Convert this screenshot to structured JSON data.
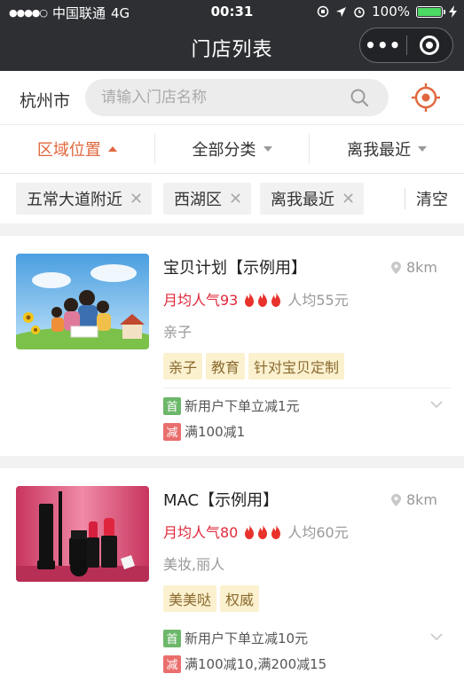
{
  "status_bar": {
    "carrier": "中国联通",
    "network": "4G",
    "time": "00:31",
    "battery": "100%"
  },
  "nav": {
    "title": "门店列表"
  },
  "search": {
    "city": "杭州市",
    "placeholder": "请输入门店名称"
  },
  "filters": [
    {
      "label": "区域位置",
      "active": true
    },
    {
      "label": "全部分类",
      "active": false
    },
    {
      "label": "离我最近",
      "active": false
    }
  ],
  "selected_filters": {
    "chips": [
      "五常大道附近",
      "西湖区",
      "离我最近"
    ],
    "clear_label": "清空"
  },
  "stores": [
    {
      "name": "宝贝计划【示例用】",
      "distance": "8km",
      "popularity": "月均人气93",
      "avg_price": "人均55元",
      "category": "亲子",
      "tags": [
        "亲子",
        "教育",
        "针对宝贝定制"
      ],
      "promos": [
        {
          "badge": "首",
          "text": "新用户下单立减1元"
        },
        {
          "badge": "减",
          "text": "满100减1"
        }
      ]
    },
    {
      "name": "MAC【示例用】",
      "distance": "8km",
      "popularity": "月均人气80",
      "avg_price": "人均60元",
      "category": "美妆,丽人",
      "tags": [
        "美美哒",
        "权威"
      ],
      "promos": [
        {
          "badge": "首",
          "text": "新用户下单立减10元"
        },
        {
          "badge": "减",
          "text": "满100减10,满200减15"
        }
      ]
    }
  ],
  "colors": {
    "accent": "#e0673d",
    "hot_text": "#e0283a",
    "tag_bg": "#fbf1cf",
    "first_badge": "#6cb76a",
    "minus_badge": "#ea6e6e",
    "navbar_bg": "#2e2f33"
  }
}
